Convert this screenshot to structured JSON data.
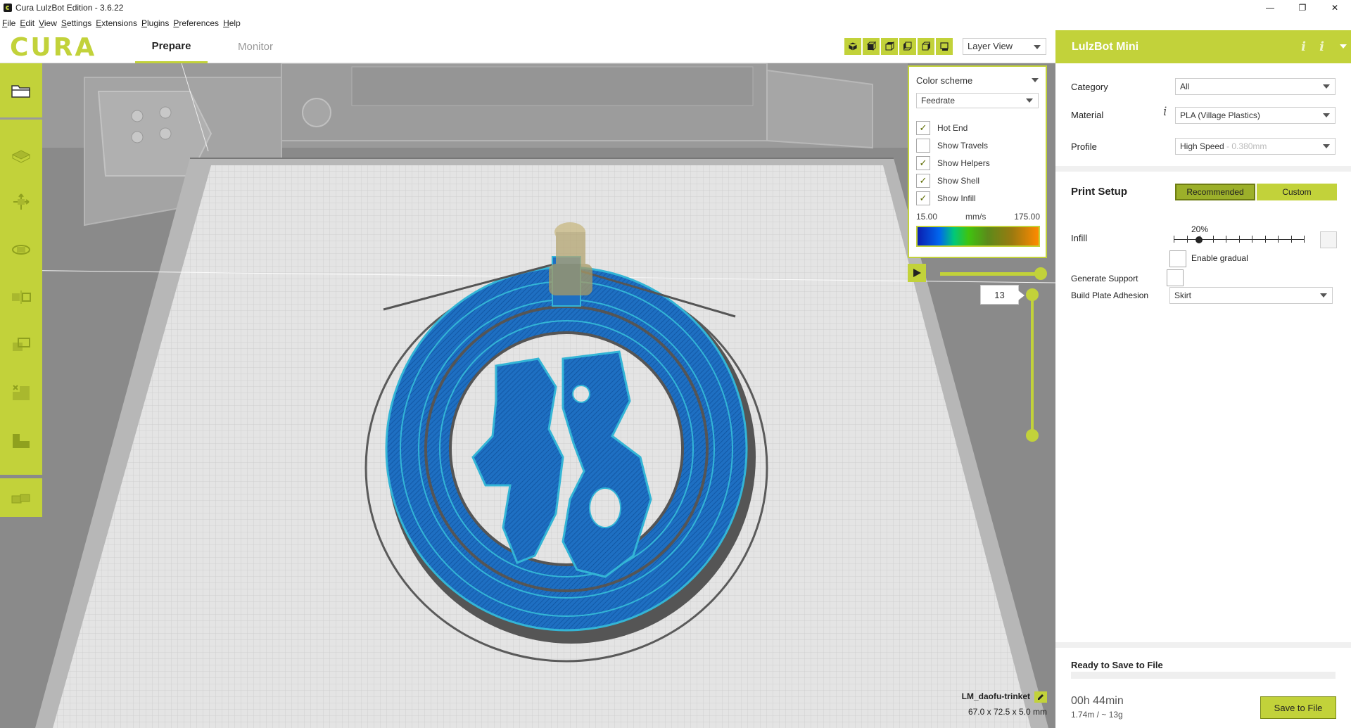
{
  "window": {
    "title": "Cura LulzBot Edition - 3.6.22",
    "controls": [
      "—",
      "❐",
      "✕"
    ]
  },
  "menu": [
    "File",
    "Edit",
    "View",
    "Settings",
    "Extensions",
    "Plugins",
    "Preferences",
    "Help"
  ],
  "header": {
    "logo_text": "CURA",
    "tabs": [
      {
        "label": "Prepare",
        "active": true
      },
      {
        "label": "Monitor",
        "active": false
      }
    ],
    "view_mode": "Layer View"
  },
  "color_scheme": {
    "title": "Color scheme",
    "selected": "Feedrate",
    "options": [
      {
        "label": "Hot End",
        "checked": true
      },
      {
        "label": "Show Travels",
        "checked": false
      },
      {
        "label": "Show Helpers",
        "checked": true
      },
      {
        "label": "Show Shell",
        "checked": true
      },
      {
        "label": "Show Infill",
        "checked": true
      }
    ],
    "min": "15.00",
    "unit": "mm/s",
    "max": "175.00"
  },
  "layer": {
    "current": "13"
  },
  "model": {
    "name": "LM_daofu-trinket",
    "dimensions": "67.0 x 72.5 x 5.0 mm"
  },
  "sidebar": {
    "printer": "LulzBot Mini",
    "category_label": "Category",
    "category_value": "All",
    "material_label": "Material",
    "material_value": "PLA (Village Plastics)",
    "profile_label": "Profile",
    "profile_value": "High Speed",
    "profile_layer": " - 0.380mm",
    "print_setup_label": "Print Setup",
    "recommended_label": "Recommended",
    "custom_label": "Custom",
    "infill_label": "Infill",
    "infill_value": "20%",
    "infill_fraction": 0.2,
    "gradual_label": "Enable gradual",
    "support_label": "Generate Support",
    "adhesion_label": "Build Plate Adhesion",
    "adhesion_value": "Skirt",
    "ready_label": "Ready to Save to File",
    "print_time": "00h 44min",
    "material_usage": "1.74m / ~ 13g",
    "save_label": "Save to File"
  },
  "colors": {
    "accent": "#c2d23a",
    "infill_blue": "#1e6fc2",
    "shell_cyan": "#33b5d6"
  }
}
